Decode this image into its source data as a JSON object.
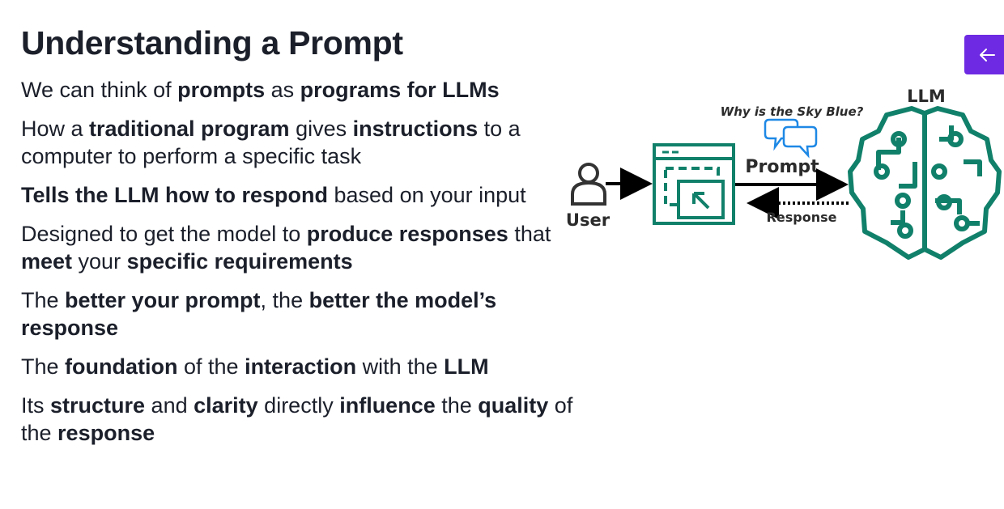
{
  "slide": {
    "title": "Understanding a Prompt",
    "bullets": [
      [
        {
          "t": "We can think of ",
          "b": false
        },
        {
          "t": "prompts",
          "b": true
        },
        {
          "t": " as ",
          "b": false
        },
        {
          "t": "programs for LLMs",
          "b": true
        }
      ],
      [
        {
          "t": "How a ",
          "b": false
        },
        {
          "t": "traditional program",
          "b": true
        },
        {
          "t": " gives ",
          "b": false
        },
        {
          "t": "instructions",
          "b": true
        },
        {
          "t": " to a computer to perform a specific task",
          "b": false
        }
      ],
      [
        {
          "t": "Tells the LLM how to respond",
          "b": true
        },
        {
          "t": " based on your input",
          "b": false
        }
      ],
      [
        {
          "t": "Designed to get the model to ",
          "b": false
        },
        {
          "t": "produce responses",
          "b": true
        },
        {
          "t": " that ",
          "b": false
        },
        {
          "t": "meet",
          "b": true
        },
        {
          "t": " your ",
          "b": false
        },
        {
          "t": "specific requirements",
          "b": true
        }
      ],
      [
        {
          "t": "The ",
          "b": false
        },
        {
          "t": "better your prompt",
          "b": true
        },
        {
          "t": ", the ",
          "b": false
        },
        {
          "t": "better the model’s response",
          "b": true
        }
      ],
      [
        {
          "t": "The ",
          "b": false
        },
        {
          "t": "foundation",
          "b": true
        },
        {
          "t": " of the ",
          "b": false
        },
        {
          "t": "interaction",
          "b": true
        },
        {
          "t": " with the ",
          "b": false
        },
        {
          "t": "LLM",
          "b": true
        }
      ],
      [
        {
          "t": "Its ",
          "b": false
        },
        {
          "t": "structure",
          "b": true
        },
        {
          "t": " and ",
          "b": false
        },
        {
          "t": "clarity",
          "b": true
        },
        {
          "t": " directly ",
          "b": false
        },
        {
          "t": "influence",
          "b": true
        },
        {
          "t": " the ",
          "b": false
        },
        {
          "t": "quality",
          "b": true
        },
        {
          "t": " of the ",
          "b": false
        },
        {
          "t": "response",
          "b": true
        }
      ]
    ]
  },
  "diagram": {
    "user_label": "User",
    "question": "Why is the Sky Blue?",
    "prompt_label": "Prompt",
    "response_label": "Response",
    "llm_label": "LLM"
  },
  "icons": {
    "back": "arrow-left-icon",
    "user": "user-icon",
    "chat": "chat-bubbles-icon",
    "program": "program-window-icon",
    "brain": "brain-circuit-icon"
  },
  "colors": {
    "accent": "#6d2ae2",
    "diagram_green": "#11806a",
    "chat_blue": "#1e88e5",
    "text": "#1b1f2a"
  }
}
